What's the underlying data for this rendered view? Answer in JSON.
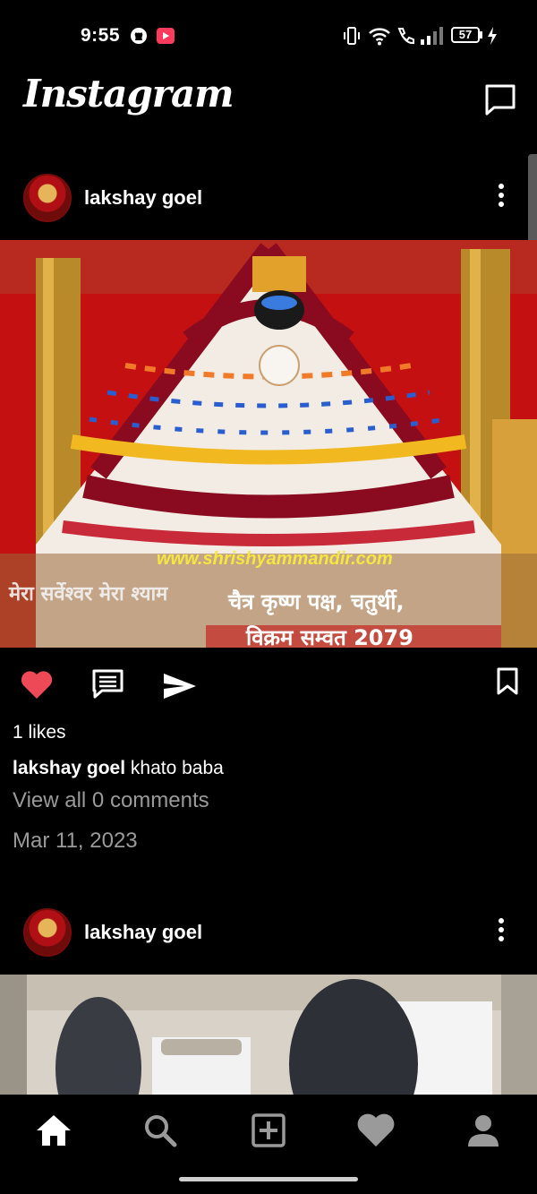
{
  "status_bar": {
    "time": "9:55",
    "battery": "57",
    "icons": [
      "github-icon",
      "youtube-icon",
      "vibrate-icon",
      "wifi-icon",
      "call-icon",
      "signal-icon",
      "battery-icon",
      "charging-icon"
    ]
  },
  "app_bar": {
    "logo": "Instagram",
    "messages_icon": "messages-icon"
  },
  "posts": [
    {
      "username": "lakshay goel",
      "image_overlay_text": {
        "watermark": "www.shrishyammandir.com",
        "line_left": "मेरा सर्वेश्वर मेरा श्याम",
        "line_right_1": "चैत्र कृष्ण पक्ष, चतुर्थी,",
        "line_right_2": "विक्रम सम्वत 2079"
      },
      "likes": "1 likes",
      "caption_user": "lakshay goel",
      "caption_text": "khato baba",
      "view_comments": "View all 0 comments",
      "date": "Mar 11, 2023",
      "liked": true
    },
    {
      "username": "lakshay goel"
    }
  ],
  "bottom_nav": {
    "items": [
      "home-icon",
      "search-icon",
      "add-post-icon",
      "activity-heart-icon",
      "profile-icon"
    ],
    "active": "home"
  },
  "colors": {
    "like_red": "#ed4956",
    "background": "#000000",
    "muted_text": "#9a9a9a"
  }
}
